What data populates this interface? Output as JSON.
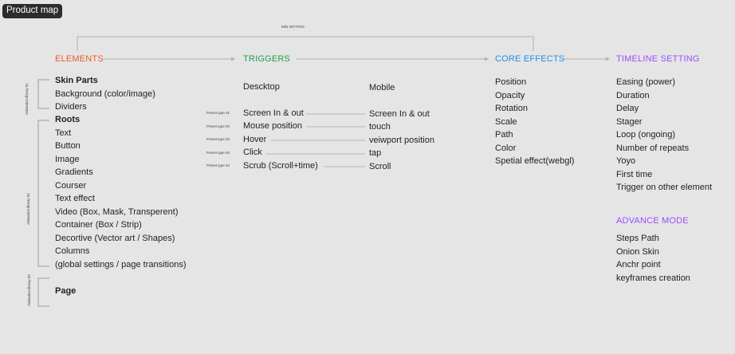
{
  "frame_label": "Product map",
  "min_setting_label": "MIN SETTING",
  "colors": {
    "elements": "#f05a28",
    "triggers": "#1fa24a",
    "core_effects": "#1e90e6",
    "timeline": "#9b4dff",
    "advance": "#9b4dff",
    "connector": "#b0b0b0",
    "bracket": "#9a9a9a"
  },
  "headers": {
    "elements": "ELEMENTS",
    "triggers": "TRIGGERS",
    "core_effects": "CORE EFFECTS",
    "timeline": "TIMELINE SETTING",
    "advance": "ADVANCE MODE"
  },
  "library_labels": [
    "Animation library 01",
    "Animation library 02",
    "Animation library 03"
  ],
  "elements": {
    "group1": [
      "Skin Parts",
      "Background (color/image)",
      "Dividers"
    ],
    "group2": [
      "Roots",
      "Text",
      "Button",
      "Image",
      "Gradients",
      "Courser",
      "Text effect",
      "Video (Box, Mask, Transperent)",
      "Container (Box / Strip)",
      "Decortive (Vector art / Shapes)",
      "Columns",
      "(global settings / page transitions)"
    ],
    "group3": [
      "Page"
    ]
  },
  "triggers": {
    "desktop_label": "Descktop",
    "mobile_label": "Mobile",
    "rows": [
      {
        "preset": "Preset type 01",
        "desktop": "Screen In & out",
        "mobile": "Screen In & out"
      },
      {
        "preset": "Preset type 02",
        "desktop": "Mouse position",
        "mobile": "touch"
      },
      {
        "preset": "Preset type 03",
        "desktop": "Hover",
        "mobile": "veiwport position"
      },
      {
        "preset": "Preset type 04",
        "desktop": "Click",
        "mobile": "tap"
      },
      {
        "preset": "Preset type 04",
        "desktop": "Scrub (Scroll+time)",
        "mobile": "Scroll"
      }
    ]
  },
  "core_effects": [
    "Position",
    "Opacity",
    "Rotation",
    "Scale",
    "Path",
    "Color",
    "Spetial effect(webgl)"
  ],
  "timeline": [
    "Easing (power)",
    "Duration",
    "Delay",
    "Stager",
    "Loop (ongoing)",
    "Number of repeats",
    "Yoyo",
    "First time",
    "Trigger on other element"
  ],
  "advance": [
    "Steps Path",
    "Onion Skin",
    "Anchr point",
    "keyframes creation"
  ]
}
